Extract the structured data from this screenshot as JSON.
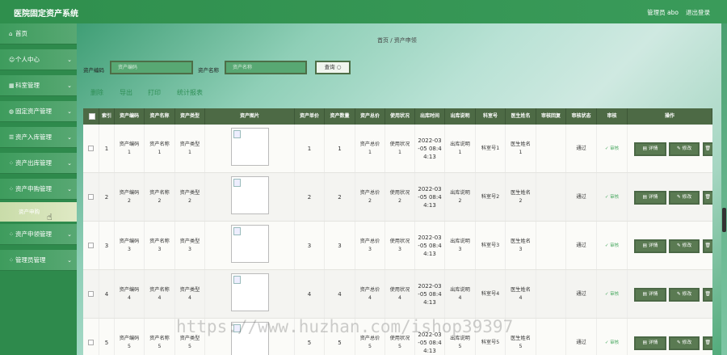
{
  "app": {
    "title": "医院固定资产系统",
    "user": "管理员 abo",
    "logout": "退出登录"
  },
  "sidebar": {
    "items": [
      {
        "label": "首页",
        "icon": "home-icon",
        "glyph": "⌂"
      },
      {
        "label": "个人中心",
        "icon": "person-icon",
        "glyph": "☺"
      },
      {
        "label": "科室管理",
        "icon": "building-icon",
        "glyph": "▦"
      },
      {
        "label": "固定资产管理",
        "icon": "asset-icon",
        "glyph": "◍"
      },
      {
        "label": "资产入库管理",
        "icon": "list-icon",
        "glyph": "☰"
      },
      {
        "label": "资产出库管理",
        "icon": "grid-icon",
        "glyph": "⁘"
      },
      {
        "label": "资产申购管理",
        "icon": "grid-icon",
        "glyph": "⁘"
      },
      {
        "label": "资产申领管理",
        "icon": "grid-icon",
        "glyph": "⁘"
      },
      {
        "label": "管理员管理",
        "icon": "grid-icon",
        "glyph": "⁘"
      }
    ],
    "sub_item": "资产申购",
    "chevron": "⌄"
  },
  "breadcrumb": "首页 / 资产申领",
  "search": {
    "code_label": "资产编码",
    "code_placeholder": "资产编码",
    "name_label": "资产名称",
    "name_placeholder": "资产名称",
    "button": "查询 ○"
  },
  "actions": [
    "删除",
    "导出",
    "打印",
    "统计报表"
  ],
  "table": {
    "headers": [
      "",
      "索引",
      "资产编码",
      "资产名称",
      "资产类型",
      "资产图片",
      "资产单价",
      "资产数量",
      "资产总价",
      "使用状况",
      "出库时间",
      "出库说明",
      "科室号",
      "医生姓名",
      "审核回复",
      "审核状态",
      "审核",
      "操作"
    ],
    "rows": [
      {
        "index": "1",
        "code": "资产编码\n1",
        "name": "资产名称\n1",
        "type": "资产类型\n1",
        "price": "1",
        "qty": "1",
        "total": "资产总价\n1",
        "status": "使用状况\n1",
        "time": "2022-03\n-05 08:4\n4:13",
        "note": "出库说明\n1",
        "dept": "科室号1",
        "doctor": "医生姓名\n1",
        "reply": "",
        "audit_status": "通过",
        "audit": "✓ 审核"
      },
      {
        "index": "2",
        "code": "资产编码\n2",
        "name": "资产名称\n2",
        "type": "资产类型\n2",
        "price": "2",
        "qty": "2",
        "total": "资产总价\n2",
        "status": "使用状况\n2",
        "time": "2022-03\n-05 08:4\n4:13",
        "note": "出库说明\n2",
        "dept": "科室号2",
        "doctor": "医生姓名\n2",
        "reply": "",
        "audit_status": "通过",
        "audit": "✓ 审核"
      },
      {
        "index": "3",
        "code": "资产编码\n3",
        "name": "资产名称\n3",
        "type": "资产类型\n3",
        "price": "3",
        "qty": "3",
        "total": "资产总价\n3",
        "status": "使用状况\n3",
        "time": "2022-03\n-05 08:4\n4:13",
        "note": "出库说明\n3",
        "dept": "科室号3",
        "doctor": "医生姓名\n3",
        "reply": "",
        "audit_status": "通过",
        "audit": "✓ 审核"
      },
      {
        "index": "4",
        "code": "资产编码\n4",
        "name": "资产名称\n4",
        "type": "资产类型\n4",
        "price": "4",
        "qty": "4",
        "total": "资产总价\n4",
        "status": "使用状况\n4",
        "time": "2022-03\n-05 08:4\n4:13",
        "note": "出库说明\n4",
        "dept": "科室号4",
        "doctor": "医生姓名\n4",
        "reply": "",
        "audit_status": "通过",
        "audit": "✓ 审核"
      },
      {
        "index": "5",
        "code": "资产编码\n5",
        "name": "资产名称\n5",
        "type": "资产类型\n5",
        "price": "5",
        "qty": "5",
        "total": "资产总价\n5",
        "status": "使用状况\n5",
        "time": "2022-03\n-05 08:4\n4:13",
        "note": "出库说明\n5",
        "dept": "科室号5",
        "doctor": "医生姓名\n5",
        "reply": "",
        "audit_status": "通过",
        "audit": "✓ 审核"
      }
    ],
    "row_actions": {
      "detail": "▤ 详情",
      "edit": "✎ 修改",
      "delete": "🗑 删"
    }
  },
  "watermark": "https://www.huzhan.com/ishop39397"
}
